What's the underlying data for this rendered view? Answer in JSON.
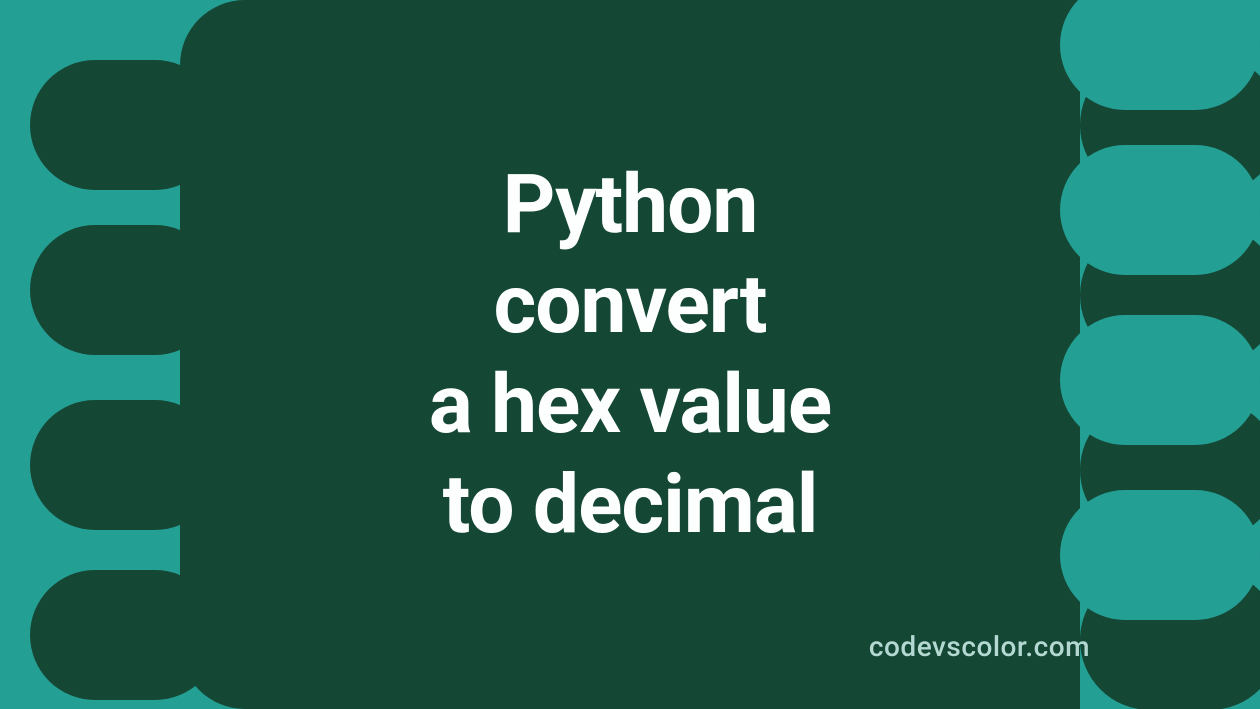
{
  "title_line1": "Python",
  "title_line2": "convert",
  "title_line3": "a hex value",
  "title_line4": "to decimal",
  "watermark": "codevscolor.com",
  "colors": {
    "background": "#249f94",
    "foreground_shape": "#154735",
    "text": "#fdfffe",
    "watermark": "#b4d9d2"
  }
}
